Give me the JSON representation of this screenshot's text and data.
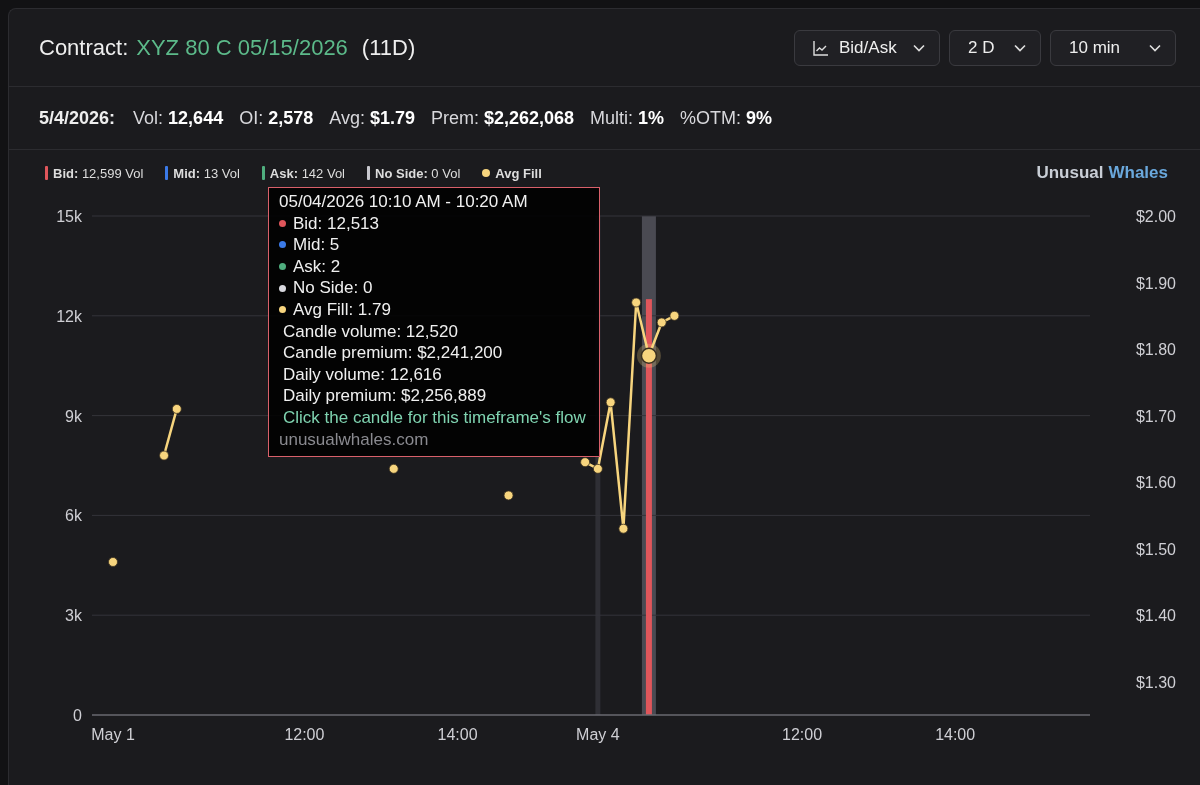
{
  "header": {
    "label": "Contract:",
    "contract": "XYZ 80 C 05/15/2026",
    "days": "(11D)",
    "dropdowns": [
      {
        "label": "Bid/Ask"
      },
      {
        "label": "2 D"
      },
      {
        "label": "10 min"
      }
    ]
  },
  "stats": {
    "date": "5/4/2026:",
    "items": [
      {
        "label": "Vol:",
        "value": "12,644"
      },
      {
        "label": "OI:",
        "value": "2,578"
      },
      {
        "label": "Avg:",
        "value": "$1.79"
      },
      {
        "label": "Prem:",
        "value": "$2,262,068"
      },
      {
        "label": "Multi:",
        "value": "1%"
      },
      {
        "label": "%OTM:",
        "value": "9%"
      }
    ]
  },
  "legend": [
    {
      "label": "Bid:",
      "value": "12,599 Vol",
      "color": "#e0565b",
      "kind": "bar"
    },
    {
      "label": "Mid:",
      "value": "13 Vol",
      "color": "#3b7ae8",
      "kind": "bar"
    },
    {
      "label": "Ask:",
      "value": "142 Vol",
      "color": "#4fae7e",
      "kind": "bar"
    },
    {
      "label": "No Side:",
      "value": "0 Vol",
      "color": "#c9c9cf",
      "kind": "bar"
    },
    {
      "label": "Avg Fill",
      "color": "#f7d57e",
      "kind": "dot"
    }
  ],
  "brand": [
    "Unusual",
    "Whales"
  ],
  "chart_data": {
    "type": "bar",
    "categories": [
      "May 1",
      null,
      null,
      null,
      null,
      null,
      null,
      null,
      null,
      null,
      null,
      null,
      null,
      null,
      null,
      "12:00",
      null,
      null,
      null,
      null,
      null,
      null,
      null,
      null,
      null,
      null,
      null,
      "14:00",
      null,
      null,
      null,
      null,
      null,
      null,
      null,
      null,
      null,
      null,
      "May 4",
      null,
      null,
      null,
      null,
      null,
      null,
      null,
      null,
      null,
      null,
      null,
      null,
      null,
      null,
      null,
      "12:00",
      null,
      null,
      null,
      null,
      null,
      null,
      null,
      null,
      null,
      null,
      null,
      "14:00",
      null,
      null,
      null,
      null,
      null,
      null,
      null,
      null,
      null,
      null
    ],
    "series": [
      {
        "color": "#e0565b",
        "values": [
          null,
          null,
          null,
          null,
          null,
          null,
          null,
          null,
          null,
          null,
          null,
          null,
          null,
          null,
          null,
          null,
          null,
          null,
          null,
          null,
          null,
          null,
          null,
          null,
          null,
          null,
          null,
          null,
          null,
          null,
          null,
          null,
          null,
          null,
          null,
          null,
          null,
          null,
          null,
          null,
          null,
          null,
          12500,
          null,
          null,
          null,
          null,
          null,
          null,
          null,
          null,
          null,
          null,
          null,
          null,
          null,
          null,
          null,
          null,
          null,
          null,
          null,
          null,
          null,
          null,
          null,
          null,
          null,
          null,
          null,
          null,
          null,
          null,
          null,
          null,
          null,
          null
        ]
      },
      {
        "color": "#f7d57e",
        "type": "line",
        "axis": "y2",
        "marker": "circle",
        "values": [
          1.48,
          null,
          null,
          null,
          1.64,
          1.71,
          null,
          null,
          null,
          null,
          null,
          null,
          null,
          null,
          null,
          null,
          null,
          null,
          null,
          null,
          null,
          null,
          1.62,
          null,
          null,
          null,
          null,
          null,
          null,
          null,
          null,
          1.58,
          null,
          null,
          null,
          null,
          null,
          1.63,
          1.62,
          1.72,
          1.53,
          1.87,
          1.79,
          1.84,
          1.85,
          null,
          null,
          null,
          null,
          null,
          null,
          null,
          null,
          null,
          null,
          null,
          null,
          null,
          null,
          null,
          null,
          null,
          null,
          null,
          null,
          null,
          null,
          null,
          null,
          null,
          null,
          null,
          null,
          null,
          null,
          null,
          null
        ]
      }
    ],
    "ylim": [
      0,
      15000
    ],
    "y2lim": [
      1.25,
      2.0
    ],
    "yticks": [
      {
        "value": 0,
        "label": "0"
      },
      {
        "value": 3000,
        "label": "3k"
      },
      {
        "value": 6000,
        "label": "6k"
      },
      {
        "value": 9000,
        "label": "9k"
      },
      {
        "value": 12000,
        "label": "12k"
      },
      {
        "value": 15000,
        "label": "15k"
      }
    ],
    "y2ticks": [
      {
        "value": 1.3,
        "label": "$1.30"
      },
      {
        "value": 1.4,
        "label": "$1.40"
      },
      {
        "value": 1.5,
        "label": "$1.50"
      },
      {
        "value": 1.6,
        "label": "$1.60"
      },
      {
        "value": 1.7,
        "label": "$1.70"
      },
      {
        "value": 1.8,
        "label": "$1.80"
      },
      {
        "value": 1.9,
        "label": "$1.90"
      },
      {
        "value": 2.0,
        "label": "$2.00"
      }
    ],
    "grid": true
  },
  "tooltip": {
    "title": "05/04/2026 10:10 AM - 10:20 AM",
    "items": [
      {
        "text": "Bid: 12,513",
        "color": "#e0565b"
      },
      {
        "text": "Mid: 5",
        "color": "#3b7ae8"
      },
      {
        "text": "Ask: 2",
        "color": "#4fae7e"
      },
      {
        "text": "No Side: 0",
        "color": "#d8d8de"
      },
      {
        "text": "Avg Fill: 1.79",
        "color": "#f7d57e"
      }
    ],
    "lines": [
      "Candle volume: 12,520",
      "Candle premium: $2,241,200",
      "Daily volume: 12,616",
      "Daily premium: $2,256,889"
    ],
    "link": "Click the candle for this timeframe's flow",
    "site": "unusualwhales.com"
  }
}
